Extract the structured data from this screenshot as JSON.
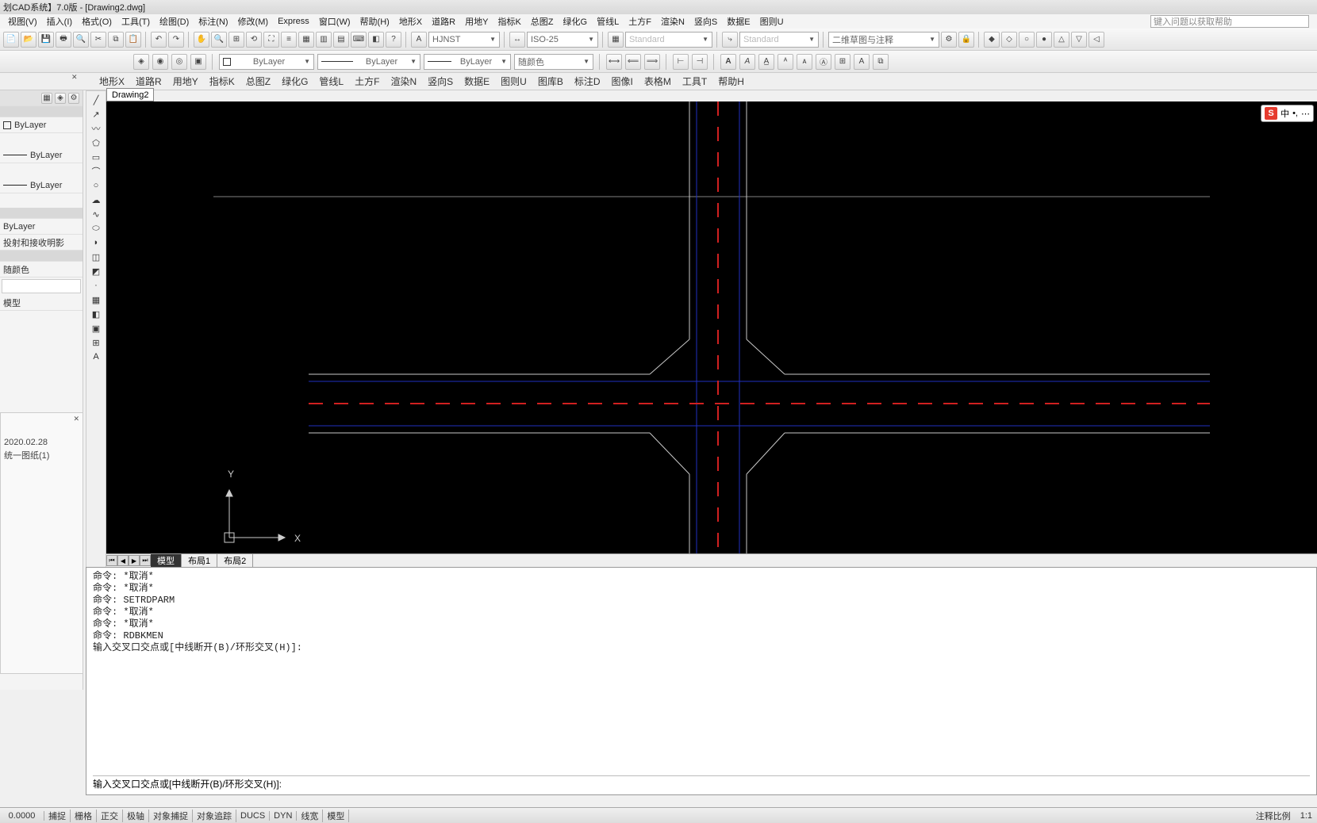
{
  "title": "划CAD系统】7.0版 - [Drawing2.dwg]",
  "menus": [
    "视图(V)",
    "插入(I)",
    "格式(O)",
    "工具(T)",
    "绘图(D)",
    "标注(N)",
    "修改(M)",
    "Express",
    "窗口(W)",
    "帮助(H)",
    "地形X",
    "道路R",
    "用地Y",
    "指标K",
    "总图Z",
    "绿化G",
    "管线L",
    "土方F",
    "渲染N",
    "竖向S",
    "数据E",
    "图则U"
  ],
  "help_placeholder": "键入问题以获取帮助",
  "style_combo1": "HJNST",
  "style_combo2": "ISO-25",
  "style_combo3": "Standard",
  "style_combo4": "Standard",
  "workspace_combo": "二维草图与注释",
  "layer_combo_label": "ByLayer",
  "color_combo_label": "随颜色",
  "ribbon_tabs": [
    "地形X",
    "道路R",
    "用地Y",
    "指标K",
    "总图Z",
    "绿化G",
    "管线L",
    "土方F",
    "渲染N",
    "竖向S",
    "数据E",
    "图则U",
    "图库B",
    "标注D",
    "图像I",
    "表格M",
    "工具T",
    "帮助H"
  ],
  "drawing_tab": "Drawing2",
  "left": {
    "layer_label": "ByLayer",
    "lt1": "ByLayer",
    "lt2": "ByLayer",
    "sel": "ByLayer",
    "shadow": "投射和接收明影",
    "color_sec": "随颜色",
    "model": "模型"
  },
  "ime": {
    "cn": "中"
  },
  "tree": {
    "date": "2020.02.28",
    "item": "统一图纸(1)"
  },
  "tabs": {
    "model": "模型",
    "layout1": "布局1",
    "layout2": "布局2"
  },
  "cmd_history": "命令: *取消*\n命令: *取消*\n命令: SETRDPARM\n命令: *取消*\n命令: *取消*\n命令: RDBKMEN\n输入交叉口交点或[中线断开(B)/环形交叉(H)]:",
  "cmd_prompt": "输入交叉口交点或[中线断开(B)/环形交叉(H)]:",
  "status": {
    "coord": "0.0000",
    "buttons": [
      "捕捉",
      "栅格",
      "正交",
      "极轴",
      "对象捕捉",
      "对象追踪",
      "DUCS",
      "DYN",
      "线宽",
      "模型"
    ],
    "scale_label": "注释比例",
    "scale": "1:1"
  },
  "ucs": {
    "x": "X",
    "y": "Y"
  }
}
